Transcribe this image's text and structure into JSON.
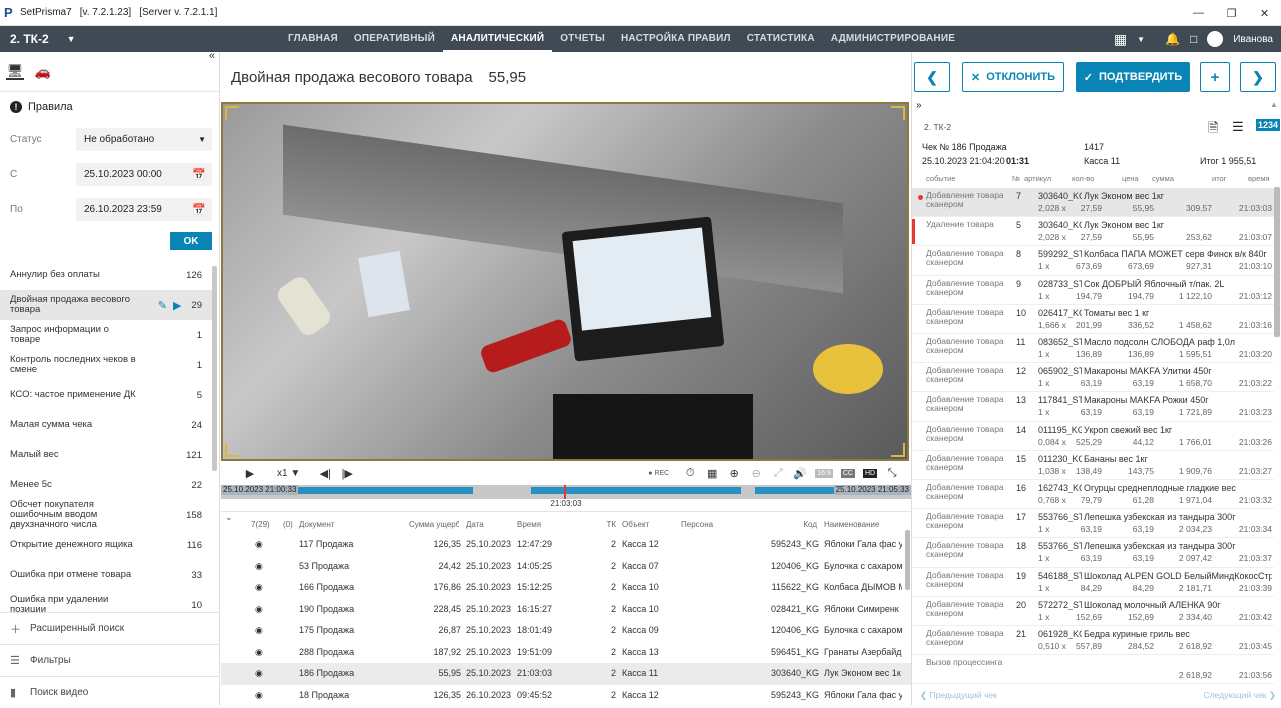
{
  "titlebar": {
    "app": "SetPrisma7",
    "version": "[v. 7.2.1.23]",
    "server": "[Server v. 7.2.1.1]"
  },
  "topbar": {
    "store": "2. ТК-2",
    "nav": [
      "ГЛАВНАЯ",
      "ОПЕРАТИВНЫЙ",
      "АНАЛИТИЧЕСКИЙ",
      "ОТЧЕТЫ",
      "НАСТРОЙКА ПРАВИЛ",
      "СТАТИСТИКА",
      "АДМИНИСТРИРОВАНИЕ"
    ],
    "active_nav": 2,
    "user": "Иванова"
  },
  "left": {
    "rules_title": "Правила",
    "status_label": "Статус",
    "status_value": "Не обработано",
    "from_label": "С",
    "from_value": "25.10.2023 00:00",
    "to_label": "По",
    "to_value": "26.10.2023 23:59",
    "ok": "OK",
    "rules": [
      {
        "name": "Аннулир без оплаты",
        "count": "126"
      },
      {
        "name": "Двойная продажа весового товара",
        "count": "29"
      },
      {
        "name": "Запрос информации о товаре",
        "count": "1"
      },
      {
        "name": "Контроль последних чеков в смене",
        "count": "1"
      },
      {
        "name": "КСО: частое применение ДК",
        "count": "5"
      },
      {
        "name": "Малая сумма чека",
        "count": "24"
      },
      {
        "name": "Малый вес",
        "count": "121"
      },
      {
        "name": "Менее 5с",
        "count": "22"
      },
      {
        "name": "Обсчет покупателя ошибочным вводом двухзначного числа",
        "count": "158"
      },
      {
        "name": "Открытие денежного ящика",
        "count": "116"
      },
      {
        "name": "Ошибка при отмене товара",
        "count": "33"
      },
      {
        "name": "Ошибка при удалении позиции",
        "count": "10"
      }
    ],
    "selected_rule": 1,
    "bottom": [
      "Расширенный поиск",
      "Фильтры",
      "Поиск видео"
    ]
  },
  "center": {
    "title": "Двойная продажа весового товара",
    "amount": "55,95",
    "controls": {
      "speed": "х1",
      "rec": "REC",
      "ratio": "16:9",
      "cc": "CC",
      "hd": "HD"
    },
    "timeline": {
      "start": "25.10.2023 21:00:33",
      "end": "25.10.2023 21:05:33",
      "mid": "21:03:03"
    },
    "grid_headers": [
      "7(29)",
      "(0)",
      "Документ",
      "Сумма ущерба",
      "Дата",
      "Время",
      "ТК",
      "Объект",
      "Персона",
      "Код",
      "Наименование"
    ],
    "grid_rows": [
      [
        "117 Продажа",
        "126,35",
        "25.10.2023",
        "12:47:29",
        "2",
        "Касса 12",
        "595243_KG",
        "Яблоки Гала фас у"
      ],
      [
        "53 Продажа",
        "24,42",
        "25.10.2023",
        "14:05:25",
        "2",
        "Касса 07",
        "120406_KG",
        "Булочка с сахаром"
      ],
      [
        "166 Продажа",
        "176,86",
        "25.10.2023",
        "15:12:25",
        "2",
        "Касса 10",
        "115622_KG",
        "Колбаса ДЫМОВ М"
      ],
      [
        "190 Продажа",
        "228,45",
        "25.10.2023",
        "16:15:27",
        "2",
        "Касса 10",
        "028421_KG",
        "Яблоки Симиренк"
      ],
      [
        "175 Продажа",
        "26,87",
        "25.10.2023",
        "18:01:49",
        "2",
        "Касса 09",
        "120406_KG",
        "Булочка с сахаром"
      ],
      [
        "288 Продажа",
        "187,92",
        "25.10.2023",
        "19:51:09",
        "2",
        "Касса 13",
        "596451_KG",
        "Гранаты Азербайд"
      ],
      [
        "186 Продажа",
        "55,95",
        "25.10.2023",
        "21:03:03",
        "2",
        "Касса 11",
        "303640_KG",
        "Лук Эконом вес 1к"
      ],
      [
        "18 Продажа",
        "126,35",
        "26.10.2023",
        "09:45:52",
        "2",
        "Касса 12",
        "595243_KG",
        "Яблоки Гала фас у"
      ]
    ],
    "selected_row": 6
  },
  "right": {
    "reject": "ОТКЛОНИТЬ",
    "confirm": "ПОДТВЕРДИТЬ",
    "store": "2. ТК-2",
    "check": "Чек № 186 Продажа",
    "check_no": "1417",
    "datetime": "25.10.2023 21:04:20",
    "duration": "01:31",
    "kassa": "Касса 11",
    "total": "Итог 1 955,51",
    "mode_label": "1234",
    "columns": [
      "событие",
      "№",
      "артикул",
      "кол-во",
      "цена",
      "сумма",
      "итог",
      "время"
    ],
    "events": [
      {
        "name": "Добавление товара сканером",
        "n": "7",
        "code": "303640_KG",
        "title": "Лук Эконом вес 1кг",
        "qty": "2,028 х",
        "price": "27,59",
        "sum": "55,95",
        "total": "309,57",
        "time": "21:03:03"
      },
      {
        "name": "Удаление товара",
        "n": "5",
        "code": "303640_KG",
        "title": "Лук Эконом вес 1кг",
        "qty": "2,028 х",
        "price": "27,59",
        "sum": "55,95",
        "total": "253,62",
        "time": "21:03:07"
      },
      {
        "name": "Добавление товара сканером",
        "n": "8",
        "code": "599292_ST",
        "title": "Колбаса ПАПА МОЖЕТ серв Финск в/к 840г",
        "qty": "1 х",
        "price": "673,69",
        "sum": "673,69",
        "total": "927,31",
        "time": "21:03:10"
      },
      {
        "name": "Добавление товара сканером",
        "n": "9",
        "code": "028733_ST",
        "title": "Сок ДОБРЫЙ Яблочный т/пак. 2L",
        "qty": "1 х",
        "price": "194,79",
        "sum": "194,79",
        "total": "1 122,10",
        "time": "21:03:12"
      },
      {
        "name": "Добавление товара сканером",
        "n": "10",
        "code": "026417_KG",
        "title": "Томаты вес 1 кг",
        "qty": "1,666 х",
        "price": "201,99",
        "sum": "336,52",
        "total": "1 458,62",
        "time": "21:03:16"
      },
      {
        "name": "Добавление товара сканером",
        "n": "11",
        "code": "083652_ST",
        "title": "Масло подсолн СЛОБОДА раф 1,0л",
        "qty": "1 х",
        "price": "136,89",
        "sum": "136,89",
        "total": "1 595,51",
        "time": "21:03:20"
      },
      {
        "name": "Добавление товара сканером",
        "n": "12",
        "code": "065902_ST",
        "title": "Макароны MAKFA Улитки 450г",
        "qty": "1 х",
        "price": "63,19",
        "sum": "63,19",
        "total": "1 658,70",
        "time": "21:03:22"
      },
      {
        "name": "Добавление товара сканером",
        "n": "13",
        "code": "117841_ST",
        "title": "Макароны MAKFA Рожки 450г",
        "qty": "1 х",
        "price": "63,19",
        "sum": "63,19",
        "total": "1 721,89",
        "time": "21:03:23"
      },
      {
        "name": "Добавление товара сканером",
        "n": "14",
        "code": "011195_KG",
        "title": "Укроп свежий вес 1кг",
        "qty": "0,084 х",
        "price": "525,29",
        "sum": "44,12",
        "total": "1 766,01",
        "time": "21:03:26"
      },
      {
        "name": "Добавление товара сканером",
        "n": "15",
        "code": "011230_KG",
        "title": "Бананы вес 1кг",
        "qty": "1,038 х",
        "price": "138,49",
        "sum": "143,75",
        "total": "1 909,76",
        "time": "21:03:27"
      },
      {
        "name": "Добавление товара сканером",
        "n": "16",
        "code": "162743_KG",
        "title": "Огурцы среднеплодные гладкие вес",
        "qty": "0,768 х",
        "price": "79,79",
        "sum": "61,28",
        "total": "1 971,04",
        "time": "21:03:32"
      },
      {
        "name": "Добавление товара сканером",
        "n": "17",
        "code": "553766_ST",
        "title": "Лепешка узбекская из тандыра 300г",
        "qty": "1 х",
        "price": "63,19",
        "sum": "63,19",
        "total": "2 034,23",
        "time": "21:03:34"
      },
      {
        "name": "Добавление товара сканером",
        "n": "18",
        "code": "553766_ST",
        "title": "Лепешка узбекская из тандыра 300г",
        "qty": "1 х",
        "price": "63,19",
        "sum": "63,19",
        "total": "2 097,42",
        "time": "21:03:37"
      },
      {
        "name": "Добавление товара сканером",
        "n": "19",
        "code": "546188_ST",
        "title": "Шоколад ALPEN GOLD БелыйМиндКокосСтруж",
        "qty": "1 х",
        "price": "84,29",
        "sum": "84,29",
        "total": "2 181,71",
        "time": "21:03:39"
      },
      {
        "name": "Добавление товара сканером",
        "n": "20",
        "code": "572272_ST",
        "title": "Шоколад молочный АЛЕНКА 90г",
        "qty": "1 х",
        "price": "152,69",
        "sum": "152,69",
        "total": "2 334,40",
        "time": "21:03:42"
      },
      {
        "name": "Добавление товара сканером",
        "n": "21",
        "code": "061928_KG",
        "title": "Бедра куриные гриль вес",
        "qty": "0,510 х",
        "price": "557,89",
        "sum": "284,52",
        "total": "2 618,92",
        "time": "21:03:45"
      },
      {
        "name": "Вызов процессинга",
        "n": "",
        "code": "",
        "title": "",
        "qty": "",
        "price": "",
        "sum": "",
        "total": "2 618,92",
        "time": "21:03:56"
      }
    ],
    "prev": "Предыдущий чек",
    "next": "Следующий чек"
  },
  "colors": {
    "accent": "#0a84b4",
    "topbar": "#3f4a55",
    "alert": "#e53935"
  }
}
